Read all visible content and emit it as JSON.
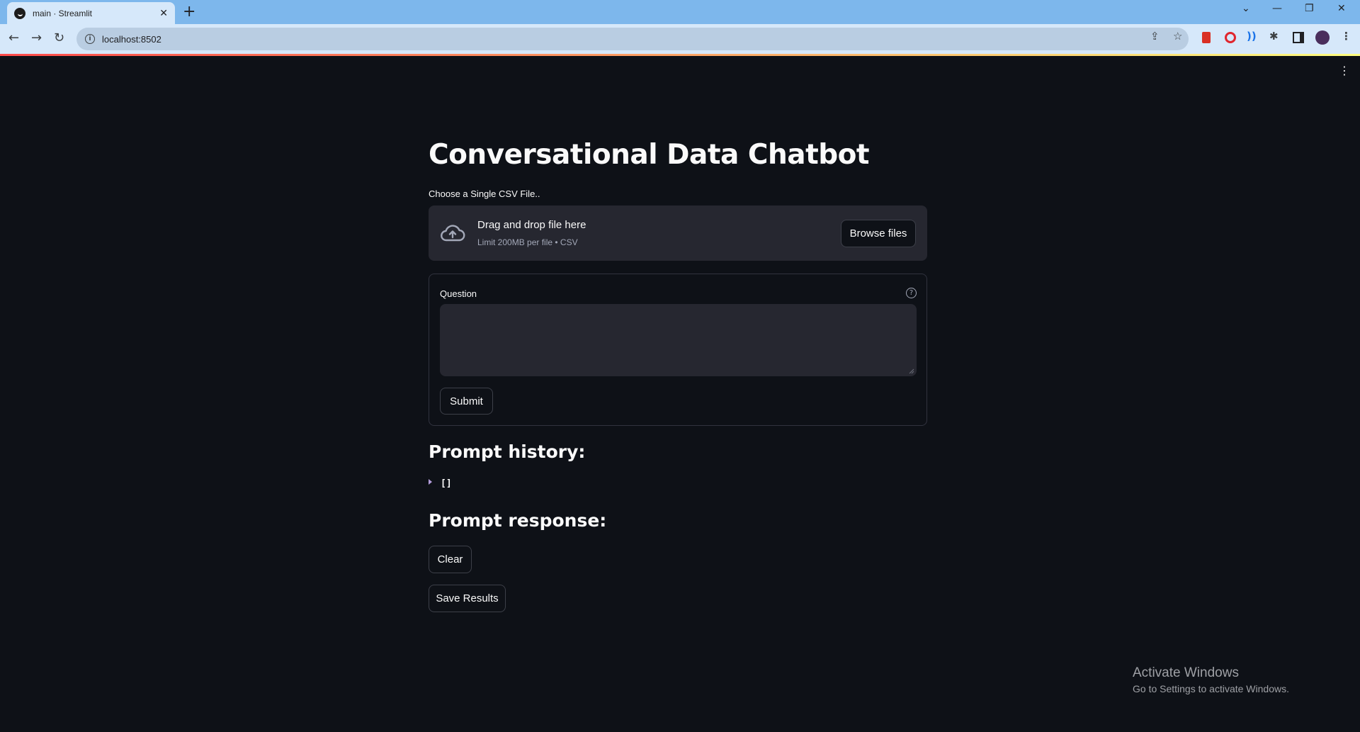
{
  "browser": {
    "tab_title": "main · Streamlit",
    "tab_close": "✕",
    "new_tab": "+",
    "url": "localhost:8502",
    "window_controls": {
      "dropdown": "⌄",
      "minimize": "—",
      "restore": "❐",
      "close": "✕"
    },
    "icons": [
      "back-arrow-icon",
      "forward-arrow-icon",
      "reload-icon",
      "site-info-icon",
      "share-icon",
      "bookmark-star-icon",
      "extensions-icon",
      "side-panel-icon",
      "profile-avatar-icon",
      "menu-kebab-icon"
    ]
  },
  "app": {
    "menu_icon": "⋮",
    "title": "Conversational Data Chatbot",
    "uploader": {
      "label": "Choose a Single CSV File..",
      "drop_text": "Drag and drop file here",
      "limit_text": "Limit 200MB per file • CSV",
      "browse_label": "Browse files"
    },
    "form": {
      "question_label": "Question",
      "help_icon": "?",
      "question_value": "",
      "submit_label": "Submit"
    },
    "history": {
      "heading": "Prompt history:",
      "value": "[]"
    },
    "response": {
      "heading": "Prompt response:"
    },
    "clear_label": "Clear",
    "save_label": "Save Results"
  },
  "os": {
    "watermark_line1": "Activate Windows",
    "watermark_line2": "Go to Settings to activate Windows."
  },
  "colors": {
    "app_background": "#0e1117",
    "widget_background": "#262730",
    "text": "#fafafa",
    "chrome_tab_strip": "#7db7ec",
    "chrome_toolbar": "#d6e8fa"
  }
}
